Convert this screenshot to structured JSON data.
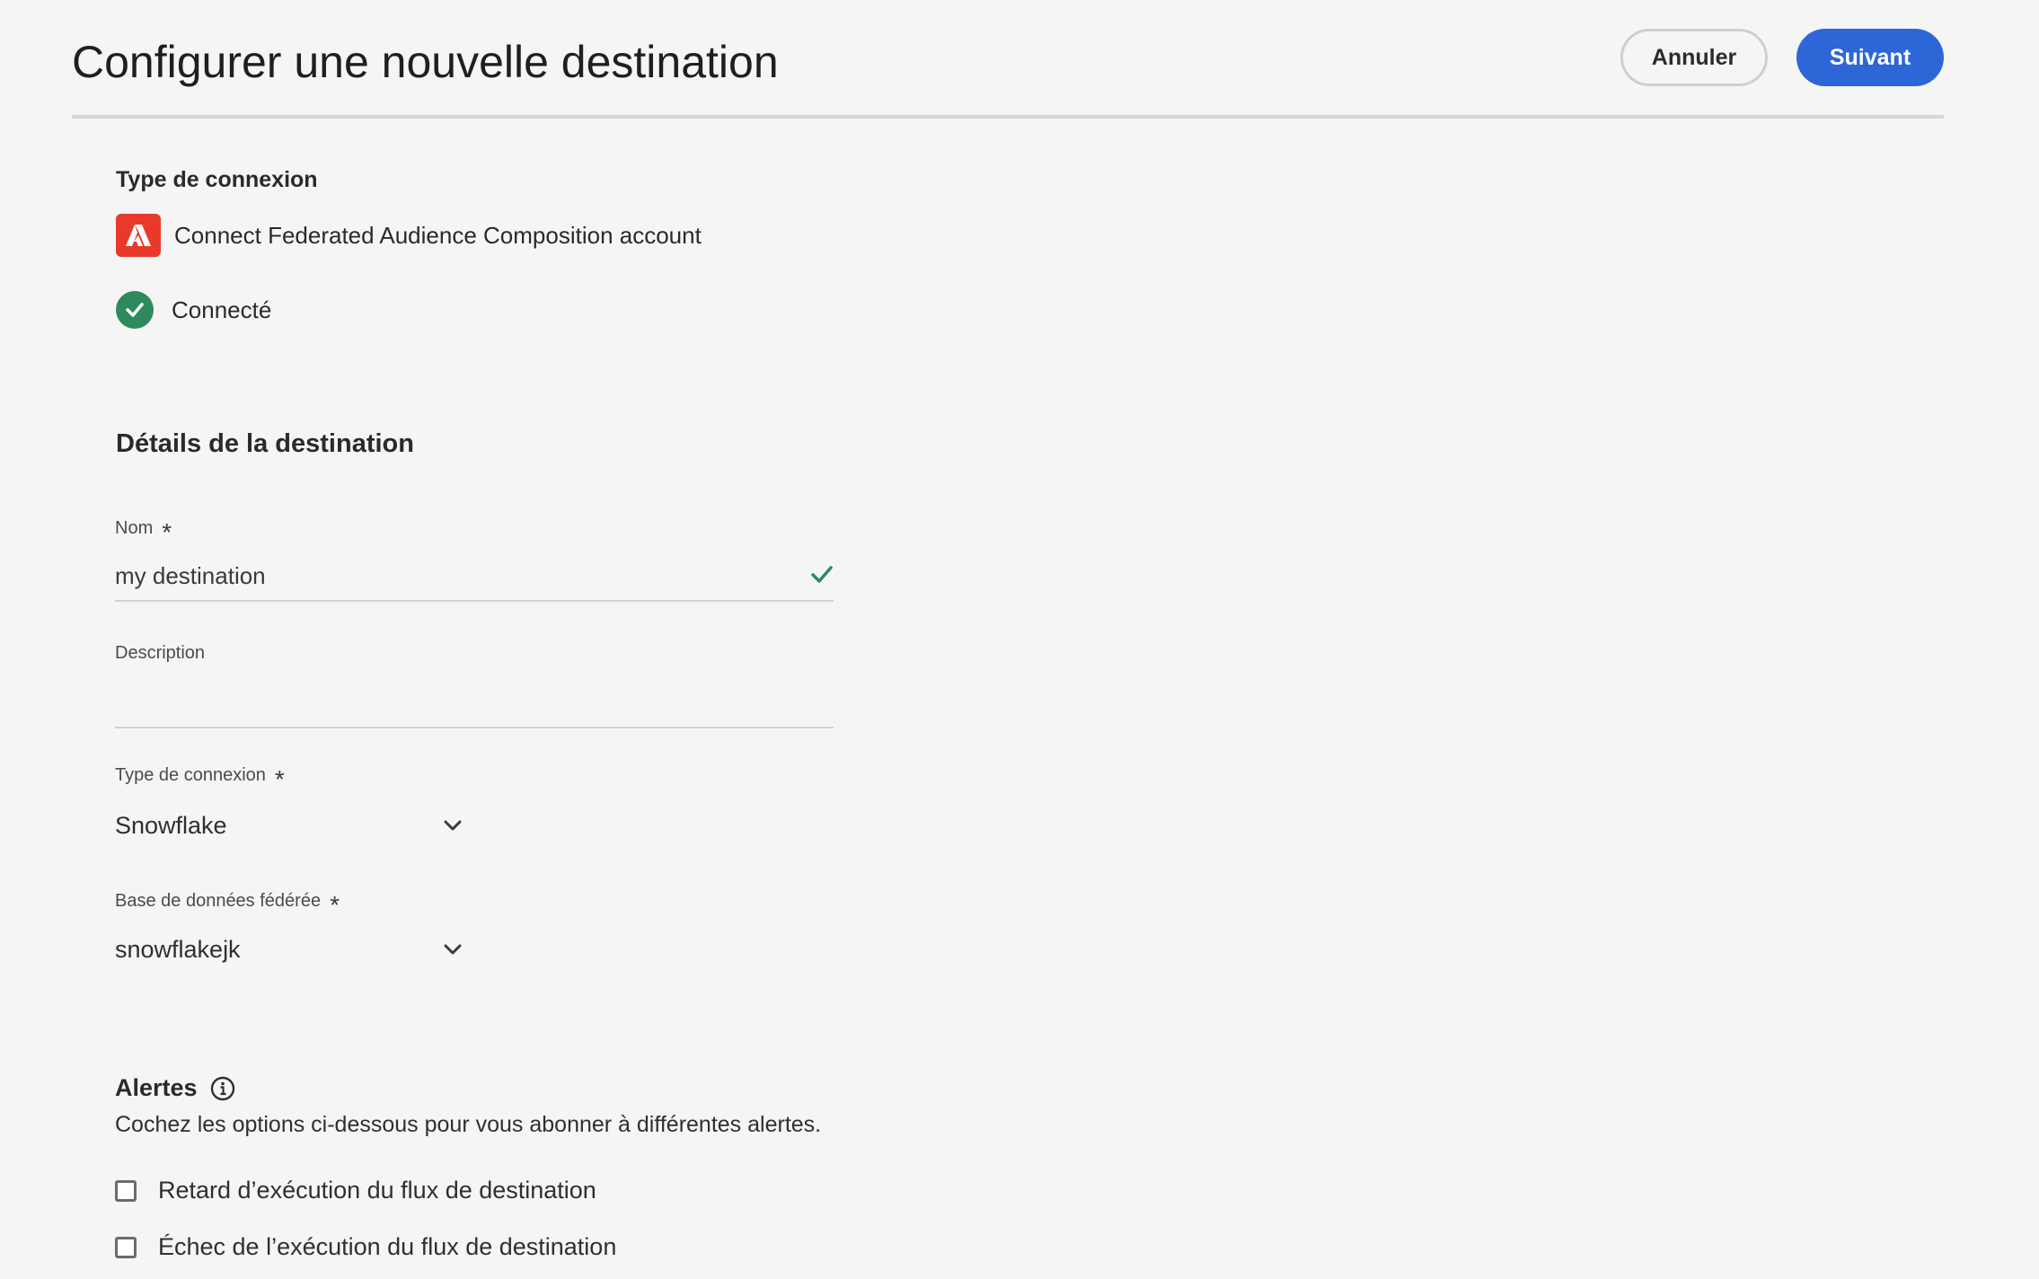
{
  "header": {
    "title": "Configurer une nouvelle destination",
    "cancel_label": "Annuler",
    "next_label": "Suivant"
  },
  "connection": {
    "section_label": "Type de connexion",
    "account_label": "Connect Federated Audience Composition account",
    "account_icon": "adobe-logo-icon",
    "status_label": "Connecté",
    "status_icon": "check-circle-icon"
  },
  "details": {
    "heading": "Détails de la destination",
    "name": {
      "label": "Nom",
      "required_marker": "*",
      "value": "my destination"
    },
    "description": {
      "label": "Description",
      "value": ""
    },
    "connection_type": {
      "label": "Type de connexion",
      "required_marker": "*",
      "value": "Snowflake"
    },
    "federated_db": {
      "label": "Base de données fédérée",
      "required_marker": "*",
      "value": "snowflakejk"
    }
  },
  "alerts": {
    "title": "Alertes",
    "description": "Cochez les options ci-dessous pour vous abonner à différentes alertes.",
    "options": [
      {
        "label": "Retard d’exécution du flux de destination",
        "checked": false
      },
      {
        "label": "Échec de l’exécution du flux de destination",
        "checked": false
      }
    ]
  },
  "colors": {
    "background": "#f5f5f5",
    "primary_button": "#2d66d6",
    "adobe_red": "#e8392b",
    "success_green": "#2d8a5c"
  }
}
